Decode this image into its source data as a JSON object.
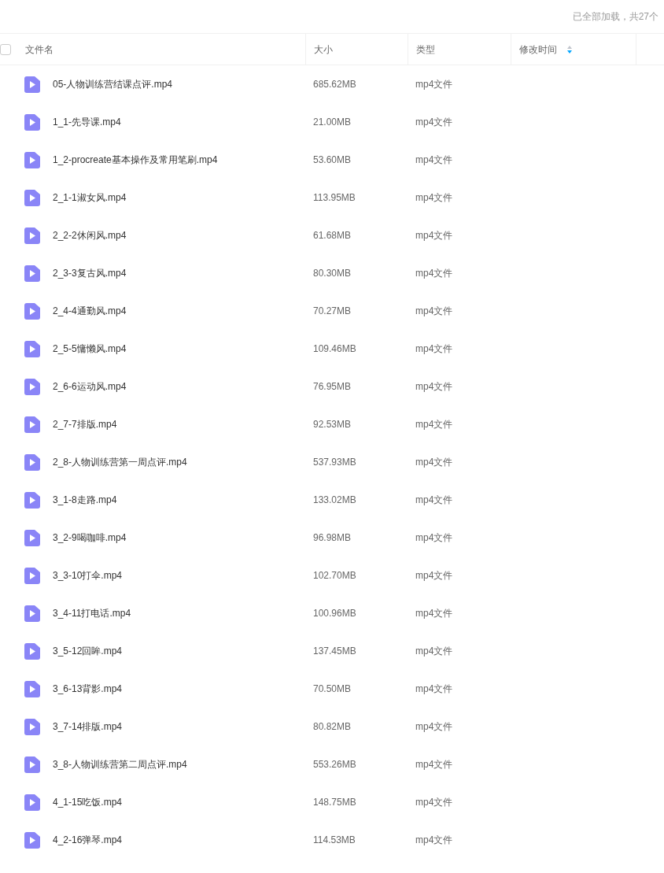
{
  "status": "已全部加载，共27个",
  "header": {
    "checked": false,
    "columns": [
      {
        "label": "文件名"
      },
      {
        "label": "大小"
      },
      {
        "label": "类型"
      },
      {
        "label": "修改时间",
        "sorted_desc": true
      }
    ]
  },
  "rows": [
    {
      "name": "05-人物训练营结课点评.mp4",
      "size": "685.62MB",
      "type": "mp4文件"
    },
    {
      "name": "1_1-先导课.mp4",
      "size": "21.00MB",
      "type": "mp4文件"
    },
    {
      "name": "1_2-procreate基本操作及常用笔刷.mp4",
      "size": "53.60MB",
      "type": "mp4文件"
    },
    {
      "name": "2_1-1淑女风.mp4",
      "size": "113.95MB",
      "type": "mp4文件"
    },
    {
      "name": "2_2-2休闲风.mp4",
      "size": "61.68MB",
      "type": "mp4文件"
    },
    {
      "name": "2_3-3复古风.mp4",
      "size": "80.30MB",
      "type": "mp4文件"
    },
    {
      "name": "2_4-4通勤风.mp4",
      "size": "70.27MB",
      "type": "mp4文件"
    },
    {
      "name": "2_5-5慵懒风.mp4",
      "size": "109.46MB",
      "type": "mp4文件"
    },
    {
      "name": "2_6-6运动风.mp4",
      "size": "76.95MB",
      "type": "mp4文件"
    },
    {
      "name": "2_7-7排版.mp4",
      "size": "92.53MB",
      "type": "mp4文件"
    },
    {
      "name": "2_8-人物训练营第一周点评.mp4",
      "size": "537.93MB",
      "type": "mp4文件"
    },
    {
      "name": "3_1-8走路.mp4",
      "size": "133.02MB",
      "type": "mp4文件"
    },
    {
      "name": "3_2-9喝咖啡.mp4",
      "size": "96.98MB",
      "type": "mp4文件"
    },
    {
      "name": "3_3-10打伞.mp4",
      "size": "102.70MB",
      "type": "mp4文件"
    },
    {
      "name": "3_4-11打电话.mp4",
      "size": "100.96MB",
      "type": "mp4文件"
    },
    {
      "name": "3_5-12回眸.mp4",
      "size": "137.45MB",
      "type": "mp4文件"
    },
    {
      "name": "3_6-13背影.mp4",
      "size": "70.50MB",
      "type": "mp4文件"
    },
    {
      "name": "3_7-14排版.mp4",
      "size": "80.82MB",
      "type": "mp4文件"
    },
    {
      "name": "3_8-人物训练营第二周点评.mp4",
      "size": "553.26MB",
      "type": "mp4文件"
    },
    {
      "name": "4_1-15吃饭.mp4",
      "size": "148.75MB",
      "type": "mp4文件"
    },
    {
      "name": "4_2-16弹琴.mp4",
      "size": "114.53MB",
      "type": "mp4文件"
    }
  ]
}
